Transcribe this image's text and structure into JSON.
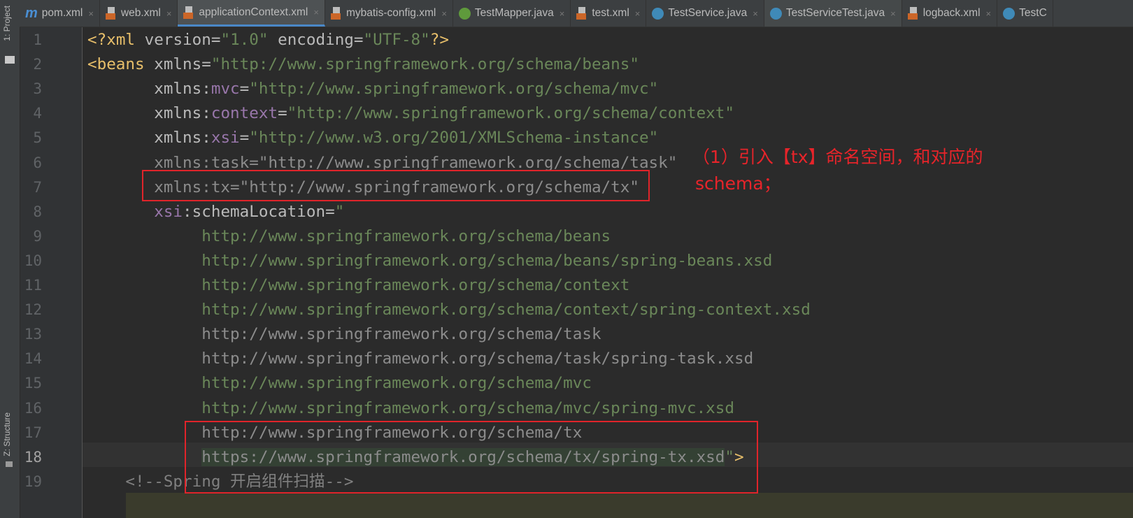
{
  "sidebar": {
    "project_label": "1: Project",
    "structure_label": "Z: Structure"
  },
  "tabs": [
    {
      "label": "pom.xml",
      "icon": "maven-icon"
    },
    {
      "label": "web.xml",
      "icon": "xml-file-icon"
    },
    {
      "label": "applicationContext.xml",
      "icon": "spring-xml-icon",
      "active": true
    },
    {
      "label": "mybatis-config.xml",
      "icon": "xml-file-icon"
    },
    {
      "label": "TestMapper.java",
      "icon": "interface-icon"
    },
    {
      "label": "test.xml",
      "icon": "xml-file-icon"
    },
    {
      "label": "TestService.java",
      "icon": "class-icon"
    },
    {
      "label": "TestServiceTest.java",
      "icon": "class-icon"
    },
    {
      "label": "logback.xml",
      "icon": "xml-file-icon"
    },
    {
      "label": "TestC",
      "icon": "class-icon"
    }
  ],
  "tab_close": "×",
  "current_line": 18,
  "lines": [
    {
      "n": "1",
      "indent": 0,
      "tokens": [
        [
          "<?",
          "tag"
        ],
        [
          "xml ",
          "tag"
        ],
        [
          "version",
          "attr"
        ],
        [
          "=",
          "attr"
        ],
        [
          "\"1.0\"",
          "str"
        ],
        [
          " encoding",
          "attr"
        ],
        [
          "=",
          "attr"
        ],
        [
          "\"UTF-8\"",
          "str"
        ],
        [
          "?>",
          "tag"
        ]
      ]
    },
    {
      "n": "2",
      "indent": 0,
      "tokens": [
        [
          "<beans ",
          "tag"
        ],
        [
          "xmlns",
          "attr"
        ],
        [
          "=",
          "attr"
        ],
        [
          "\"http://www.springframework.org/schema/beans\"",
          "str"
        ]
      ]
    },
    {
      "n": "3",
      "indent": 7,
      "tokens": [
        [
          "xmlns:",
          "attr"
        ],
        [
          "mvc",
          "ns"
        ],
        [
          "=",
          "attr"
        ],
        [
          "\"http://www.springframework.org/schema/mvc\"",
          "str"
        ]
      ]
    },
    {
      "n": "4",
      "indent": 7,
      "tokens": [
        [
          "xmlns:",
          "attr"
        ],
        [
          "context",
          "ns"
        ],
        [
          "=",
          "attr"
        ],
        [
          "\"http://www.springframework.org/schema/context\"",
          "str"
        ]
      ]
    },
    {
      "n": "5",
      "indent": 7,
      "tokens": [
        [
          "xmlns:",
          "attr"
        ],
        [
          "xsi",
          "ns"
        ],
        [
          "=",
          "attr"
        ],
        [
          "\"http://www.w3.org/2001/XMLSchema-instance\"",
          "str"
        ]
      ]
    },
    {
      "n": "6",
      "indent": 7,
      "tokens": [
        [
          "xmlns:task=\"http://www.springframework.org/schema/task\"",
          "grey"
        ]
      ]
    },
    {
      "n": "7",
      "indent": 7,
      "tokens": [
        [
          "xmlns:tx=\"http://www.springframework.org/schema/tx\"",
          "grey"
        ]
      ]
    },
    {
      "n": "8",
      "indent": 7,
      "tokens": [
        [
          "xsi",
          "ns"
        ],
        [
          ":schemaLocation",
          "attr"
        ],
        [
          "=",
          "attr"
        ],
        [
          "\"",
          "str"
        ]
      ]
    },
    {
      "n": "9",
      "indent": 12,
      "tokens": [
        [
          "http://www.springframework.org/schema/beans",
          "str"
        ]
      ]
    },
    {
      "n": "10",
      "indent": 12,
      "tokens": [
        [
          "http://www.springframework.org/schema/beans/spring-beans.xsd",
          "str"
        ]
      ]
    },
    {
      "n": "11",
      "indent": 12,
      "tokens": [
        [
          "http://www.springframework.org/schema/context",
          "str"
        ]
      ]
    },
    {
      "n": "12",
      "indent": 12,
      "tokens": [
        [
          "http://www.springframework.org/schema/context/spring-context.xsd",
          "str"
        ]
      ]
    },
    {
      "n": "13",
      "indent": 12,
      "tokens": [
        [
          "http://www.springframework.org/schema/task",
          "grey"
        ]
      ]
    },
    {
      "n": "14",
      "indent": 12,
      "tokens": [
        [
          "http://www.springframework.org/schema/task/spring-task.xsd",
          "grey"
        ]
      ]
    },
    {
      "n": "15",
      "indent": 12,
      "tokens": [
        [
          "http://www.springframework.org/schema/mvc",
          "str"
        ]
      ]
    },
    {
      "n": "16",
      "indent": 12,
      "tokens": [
        [
          "http://www.springframework.org/schema/mvc/spring-mvc.xsd",
          "str"
        ]
      ]
    },
    {
      "n": "17",
      "indent": 12,
      "tokens": [
        [
          "http://www.springframework.org/schema/tx",
          "grey"
        ]
      ]
    },
    {
      "n": "18",
      "indent": 12,
      "tokens": [
        [
          "https://www.springframework.org/schema/tx/spring-tx.xsd",
          "grey sel"
        ],
        [
          "\"",
          "str"
        ],
        [
          ">",
          "tag"
        ]
      ]
    },
    {
      "n": "19",
      "indent": 4,
      "tokens": [
        [
          "<!--Spring 开启组件扫描-->",
          "cm"
        ]
      ]
    }
  ],
  "annotation": {
    "line1": "（1）引入【tx】命名空间，和对应的",
    "line2": "schema；"
  },
  "colors": {
    "annotation": "#e8242a",
    "tag": "#e8bf6a",
    "string": "#6a8759",
    "namespace": "#9876aa"
  }
}
